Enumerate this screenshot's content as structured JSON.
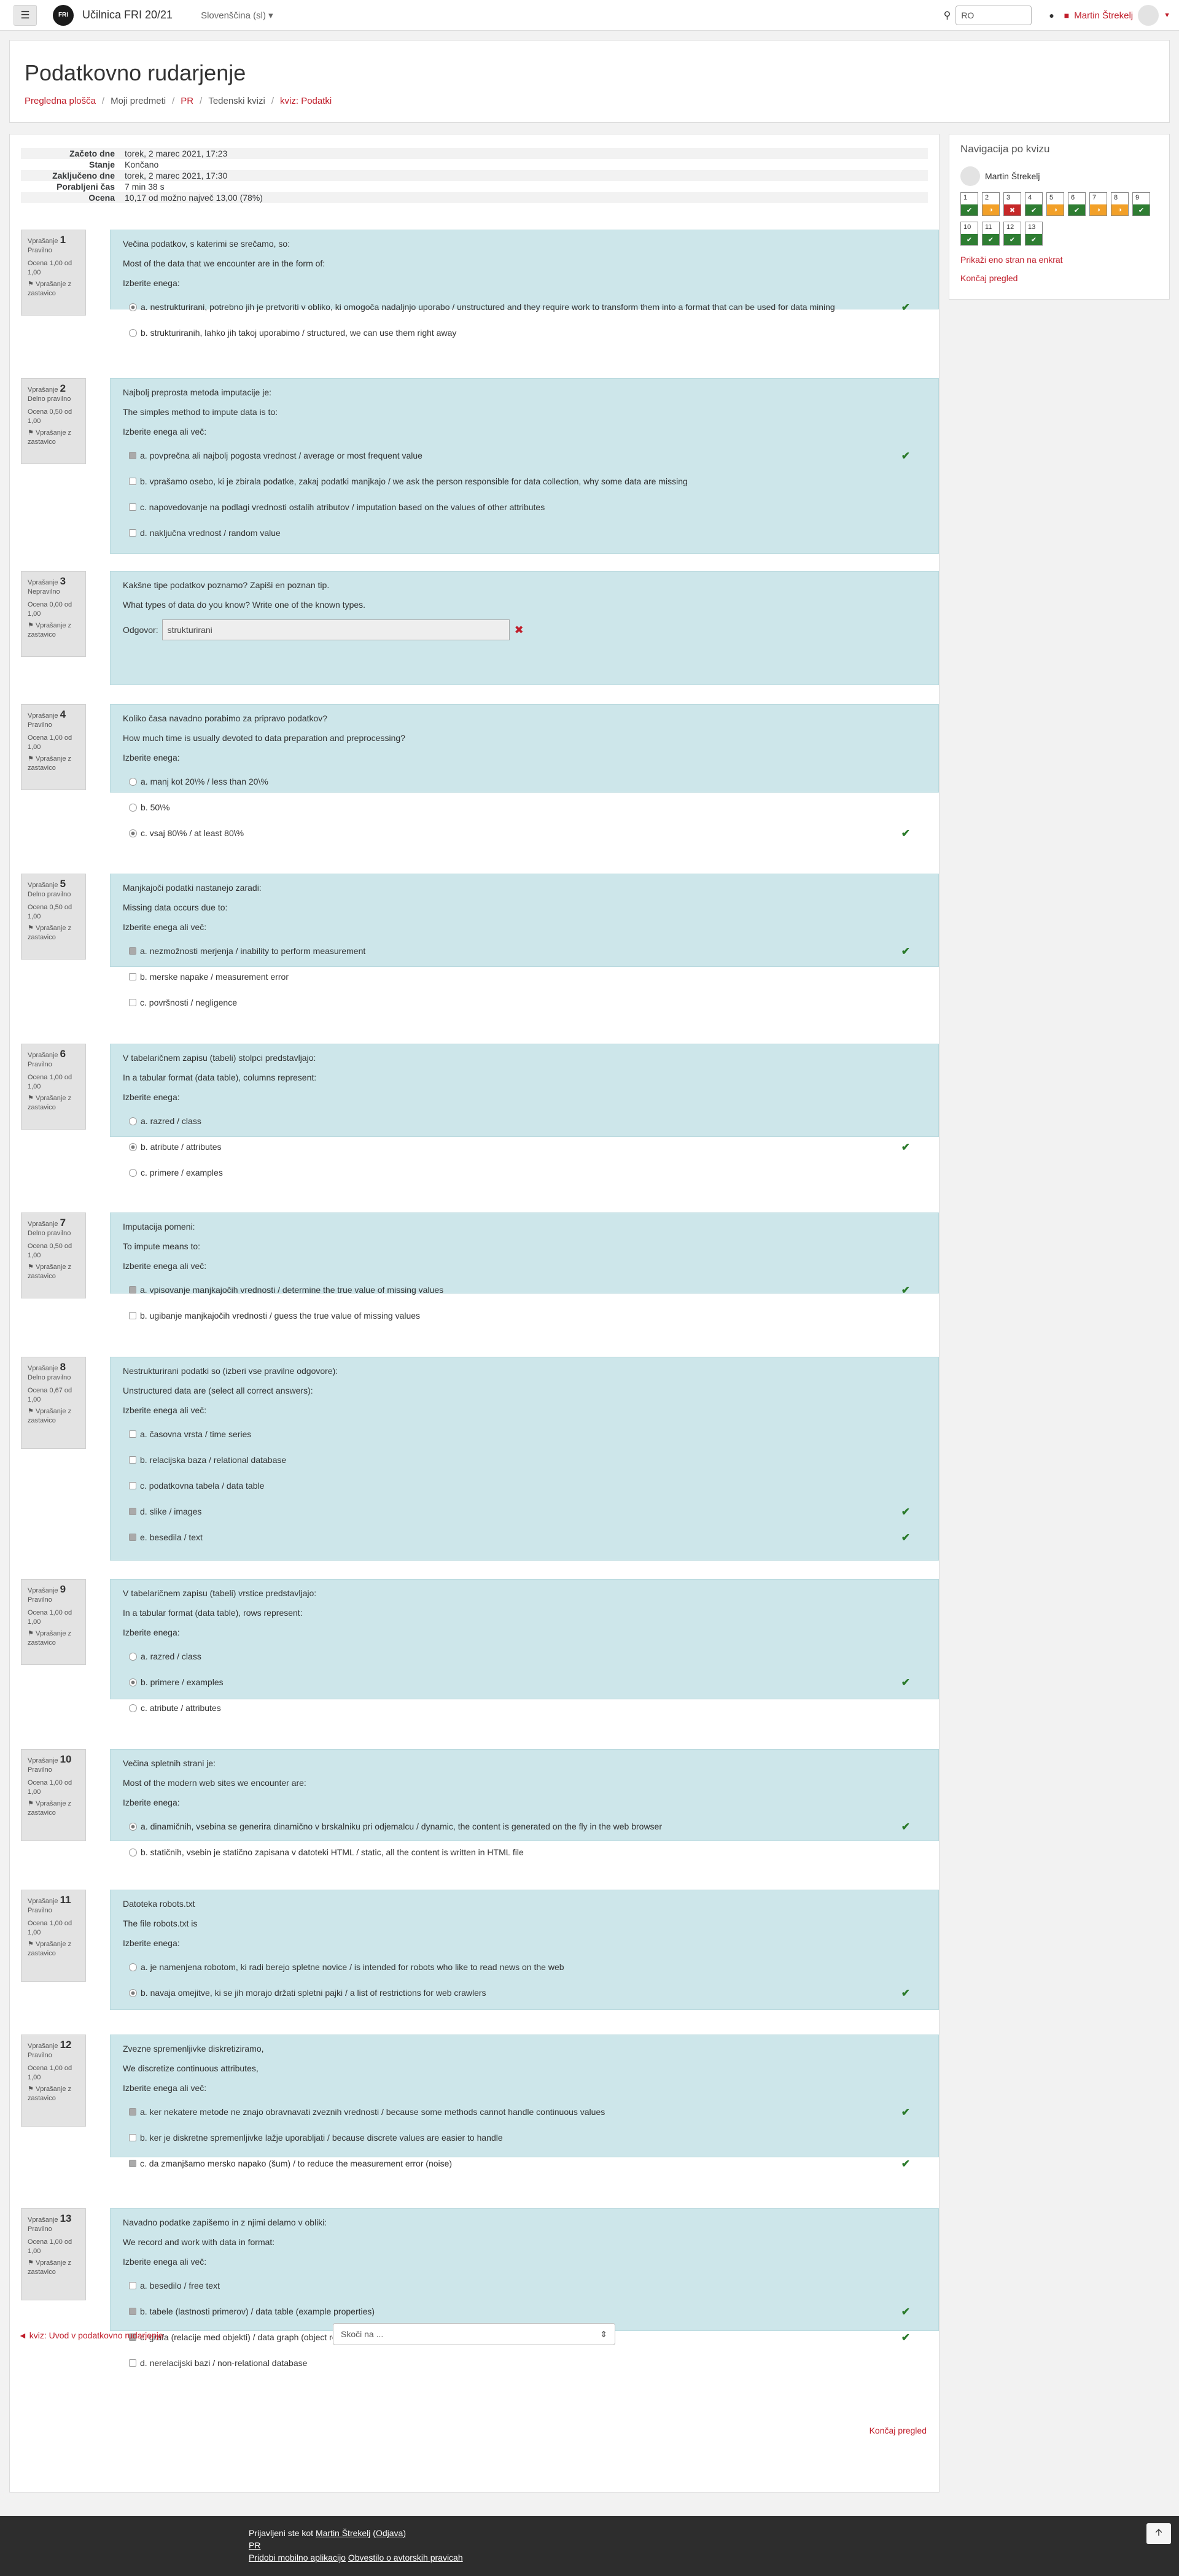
{
  "nav": {
    "site_name": "Učilnica FRI 20/21",
    "logo_text": "FRI",
    "language": "Slovenščina (sl) ▾",
    "search_value": "RO",
    "user_name": "Martin Štrekelj",
    "menu_icon": "hamburger-icon",
    "bell_icon": "bell-icon",
    "search_icon": "search-icon"
  },
  "header": {
    "title": "Podatkovno rudarjenje",
    "breadcrumb": [
      "Pregledna plošča",
      "Moji predmeti",
      "PR",
      "Tedenski kvizi",
      "kviz: Podatki"
    ]
  },
  "summary": [
    {
      "label": "Začeto dne",
      "value": "torek, 2 marec 2021, 17:23"
    },
    {
      "label": "Stanje",
      "value": "Končano"
    },
    {
      "label": "Zaključeno dne",
      "value": "torek, 2 marec 2021, 17:30"
    },
    {
      "label": "Porabljeni čas",
      "value": "7 min 38 s"
    },
    {
      "label": "Ocena",
      "value": "10,17 od možno največ 13,00 (78%)"
    }
  ],
  "flag_label": "Vprašanje z zastavico",
  "questions": [
    {
      "num": "1",
      "state": "Pravilno",
      "mark": "Ocena 1,00 od 1,00",
      "text": "Večina podatkov, s katerimi se srečamo, so:",
      "text2": "Most of the data that we encounter are in the form of:",
      "prompt": "Izberite enega:",
      "answers": [
        "a. nestrukturirani, potrebno jih je pretvoriti v obliko, ki omogoča nadaljnjo uporabo / unstructured and they require work to transform them into a format that can be used for data mining",
        "b. strukturiranih, lahko jih takoj uporabimo / structured, we can use them right away"
      ]
    },
    {
      "num": "2",
      "state": "Delno pravilno",
      "mark": "Ocena 0,50 od 1,00",
      "text": "Najbolj preprosta metoda imputacije je:",
      "text2": "The simples method to impute data is to:",
      "prompt": "Izberite enega ali več:",
      "answers": [
        "a. povprečna ali najbolj pogosta vrednost / average or most frequent value",
        "b. vprašamo osebo, ki je zbirala podatke, zakaj podatki manjkajo / we ask the person responsible for data collection, why some data are missing",
        "c. napovedovanje na podlagi vrednosti ostalih atributov / imputation based on the values of other attributes",
        "d. naključna vrednost / random value"
      ]
    },
    {
      "num": "3",
      "state": "Nepravilno",
      "mark": "Ocena 0,00 od 1,00",
      "text": "Kakšne tipe podatkov poznamo? Zapiši en poznan tip.",
      "text2": "What types of data do you know? Write one of the known types.",
      "answer_label": "Odgovor:",
      "answer_value": "strukturirani"
    },
    {
      "num": "4",
      "state": "Pravilno",
      "mark": "Ocena 1,00 od 1,00",
      "text": "Koliko časa navadno porabimo za pripravo podatkov?",
      "text2": "How much time is usually devoted to data preparation and preprocessing?",
      "prompt": "Izberite enega:",
      "answers": [
        "a. manj kot 20\\% / less than 20\\%",
        "b. 50\\%",
        "c. vsaj 80\\% / at least 80\\%"
      ]
    },
    {
      "num": "5",
      "state": "Delno pravilno",
      "mark": "Ocena 0,50 od 1,00",
      "text": "Manjkajoči podatki nastanejo zaradi:",
      "text2": "Missing data occurs due to:",
      "prompt": "Izberite enega ali več:",
      "answers": [
        "a. nezmožnosti merjenja / inability to perform measurement",
        "b. merske napake / measurement error",
        "c. površnosti / negligence"
      ]
    },
    {
      "num": "6",
      "state": "Pravilno",
      "mark": "Ocena 1,00 od 1,00",
      "text": "V tabelaričnem zapisu (tabeli) stolpci predstavljajo:",
      "text2": "In a tabular format (data table), columns represent:",
      "prompt": "Izberite enega:",
      "answers": [
        "a. razred / class",
        "b. atribute / attributes",
        "c. primere / examples"
      ]
    },
    {
      "num": "7",
      "state": "Delno pravilno",
      "mark": "Ocena 0,50 od 1,00",
      "text": "Imputacija pomeni:",
      "text2": "To impute means to:",
      "prompt": "Izberite enega ali več:",
      "answers": [
        "a. vpisovanje manjkajočih vrednosti / determine the true value of missing values",
        "b. ugibanje manjkajočih vrednosti / guess the true value of missing values"
      ]
    },
    {
      "num": "8",
      "state": "Delno pravilno",
      "mark": "Ocena 0,67 od 1,00",
      "text": "Nestrukturirani podatki so (izberi vse pravilne odgovore):",
      "text2": "Unstructured data are (select all correct answers):",
      "prompt": "Izberite enega ali več:",
      "answers": [
        "a. časovna vrsta / time series",
        "b. relacijska baza / relational database",
        "c. podatkovna tabela / data table",
        "d. slike / images",
        "e. besedila / text"
      ]
    },
    {
      "num": "9",
      "state": "Pravilno",
      "mark": "Ocena 1,00 od 1,00",
      "text": "V tabelaričnem zapisu (tabeli) vrstice predstavljajo:",
      "text2": "In a tabular format (data table), rows represent:",
      "prompt": "Izberite enega:",
      "answers": [
        "a. razred / class",
        "b. primere / examples",
        "c. atribute / attributes"
      ]
    },
    {
      "num": "10",
      "state": "Pravilno",
      "mark": "Ocena 1,00 od 1,00",
      "text": "Večina spletnih strani je:",
      "text2": "Most of the modern web sites we encounter are:",
      "prompt": "Izberite enega:",
      "answers": [
        "a. dinamičnih, vsebina se generira dinamično v brskalniku pri odjemalcu / dynamic, the content is generated on the fly in the web browser",
        "b. statičnih, vsebin je statično zapisana v datoteki HTML / static, all the content is written in HTML file"
      ]
    },
    {
      "num": "11",
      "state": "Pravilno",
      "mark": "Ocena 1,00 od 1,00",
      "text": "Datoteka robots.txt",
      "text2": "The file robots.txt is",
      "prompt": "Izberite enega:",
      "answers": [
        "a. je namenjena robotom, ki radi berejo spletne novice / is intended for robots who like to read news on the web",
        "b. navaja omejitve, ki se jih morajo držati spletni pajki / a list of restrictions for web crawlers"
      ]
    },
    {
      "num": "12",
      "state": "Pravilno",
      "mark": "Ocena 1,00 od 1,00",
      "text": "Zvezne spremenljivke diskretiziramo,",
      "text2": "We discretize continuous attributes,",
      "prompt": "Izberite enega ali več:",
      "answers": [
        "a. ker nekatere metode ne znajo obravnavati zveznih vrednosti / because some methods cannot handle continuous values",
        "b. ker je diskretne spremenljivke lažje uporabljati / because discrete values are easier to handle",
        "c. da zmanjšamo mersko napako (šum) / to reduce the measurement error (noise)"
      ]
    },
    {
      "num": "13",
      "state": "Pravilno",
      "mark": "Ocena 1,00 od 1,00",
      "text": "Navadno podatke zapišemo in z njimi delamo v obliki:",
      "text2": "We record and work with data in format:",
      "prompt": "Izberite enega ali več:",
      "answers": [
        "a. besedilo / free text",
        "b. tabele (lastnosti primerov) / data table (example properties)",
        "c. grafa (relacije med objekti) / data graph (object relations)",
        "d. nerelacijski bazi / non-relational database"
      ]
    }
  ],
  "quiznav": {
    "title": "Navigacija po kvizu",
    "user": "Martin Štrekelj",
    "cells": [
      {
        "n": "1",
        "s": "c"
      },
      {
        "n": "2",
        "s": "p"
      },
      {
        "n": "3",
        "s": "w"
      },
      {
        "n": "4",
        "s": "c"
      },
      {
        "n": "5",
        "s": "p"
      },
      {
        "n": "6",
        "s": "c"
      },
      {
        "n": "7",
        "s": "p"
      },
      {
        "n": "8",
        "s": "p"
      },
      {
        "n": "9",
        "s": "c"
      },
      {
        "n": "10",
        "s": "c"
      },
      {
        "n": "11",
        "s": "c"
      },
      {
        "n": "12",
        "s": "c"
      },
      {
        "n": "13",
        "s": "c"
      }
    ],
    "show_one_page": "Prikaži eno stran na enkrat",
    "finish_review": "Končaj pregled"
  },
  "bottom": {
    "finish_review": "Končaj pregled",
    "prev_link": "◄ kviz: Uvod v podatkovno rudarjenje",
    "jump_label": "Skoči na ..."
  },
  "footer": {
    "logged_prefix": "Prijavljeni ste kot ",
    "logged_user": "Martin Štrekelj",
    "logout": "(Odjava)",
    "course": "PR",
    "mobile_app": "Pridobi mobilno aplikacijo",
    "copyright": "Obvestilo o avtorskih pravicah"
  }
}
